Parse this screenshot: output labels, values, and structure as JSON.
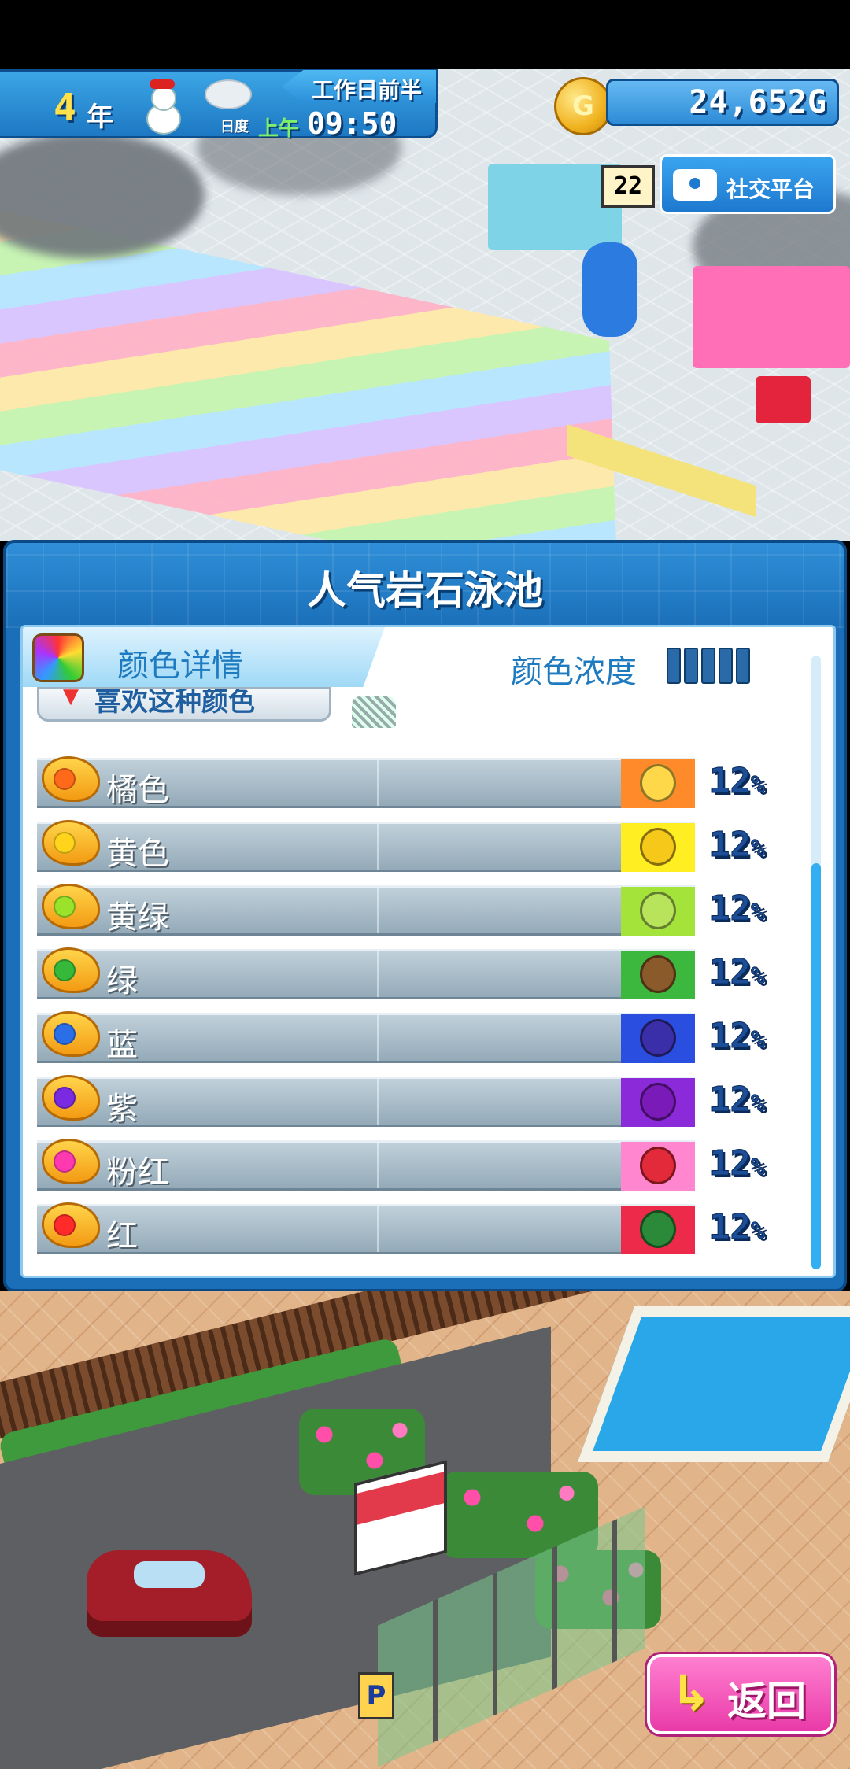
{
  "hud": {
    "year_number": "4",
    "year_label": "年",
    "period": "工作日前半",
    "day_label": "日度",
    "ampm": "上午",
    "time": "09:50",
    "money": "24,652G",
    "coin_symbol": "G"
  },
  "social": {
    "count": "22",
    "button_label": "社交平台"
  },
  "dialog": {
    "title": "人气岩石泳池",
    "header_label": "颜色详情",
    "density_label": "颜色浓度",
    "density_level": 5,
    "density_max": 5,
    "filter_label": "喜欢这种颜色"
  },
  "rows": [
    {
      "label": "橘色",
      "percent": "12",
      "blob_color": "#ff6a1a",
      "swatch_color": "#ff8a2a",
      "fruit_color": "#ffd84a",
      "fruit_icon": "orange-fruit-icon"
    },
    {
      "label": "黄色",
      "percent": "12",
      "blob_color": "#ffd41a",
      "swatch_color": "#ffef22",
      "fruit_color": "#f5c81a",
      "fruit_icon": "banana-fruit-icon"
    },
    {
      "label": "黄绿",
      "percent": "12",
      "blob_color": "#9be22a",
      "swatch_color": "#a4e43a",
      "fruit_color": "#b7e45a",
      "fruit_icon": "pear-fruit-icon"
    },
    {
      "label": "绿",
      "percent": "12",
      "blob_color": "#36b93a",
      "swatch_color": "#3cb83e",
      "fruit_color": "#8a5a2a",
      "fruit_icon": "kiwi-fruit-icon"
    },
    {
      "label": "蓝",
      "percent": "12",
      "blob_color": "#2a6ee8",
      "swatch_color": "#2a4fe0",
      "fruit_color": "#3a2fa8",
      "fruit_icon": "blueberry-fruit-icon"
    },
    {
      "label": "紫",
      "percent": "12",
      "blob_color": "#7a2ae0",
      "swatch_color": "#8a2ad8",
      "fruit_color": "#7a1ab8",
      "fruit_icon": "grape-fruit-icon"
    },
    {
      "label": "粉红",
      "percent": "12",
      "blob_color": "#ff3ab0",
      "swatch_color": "#ff86cf",
      "fruit_color": "#e22a3a",
      "fruit_icon": "strawberry-fruit-icon"
    },
    {
      "label": "红",
      "percent": "12",
      "blob_color": "#ff2a2a",
      "swatch_color": "#ee2a4a",
      "fruit_color": "#2a8a3a",
      "fruit_icon": "watermelon-fruit-icon"
    }
  ],
  "back_button": {
    "label": "返回",
    "arrow": "↳"
  },
  "colors": {
    "dialog_blue": "#1a6fb8",
    "accent_text": "#1f7bbf",
    "back_pink": "#e93aa8"
  }
}
